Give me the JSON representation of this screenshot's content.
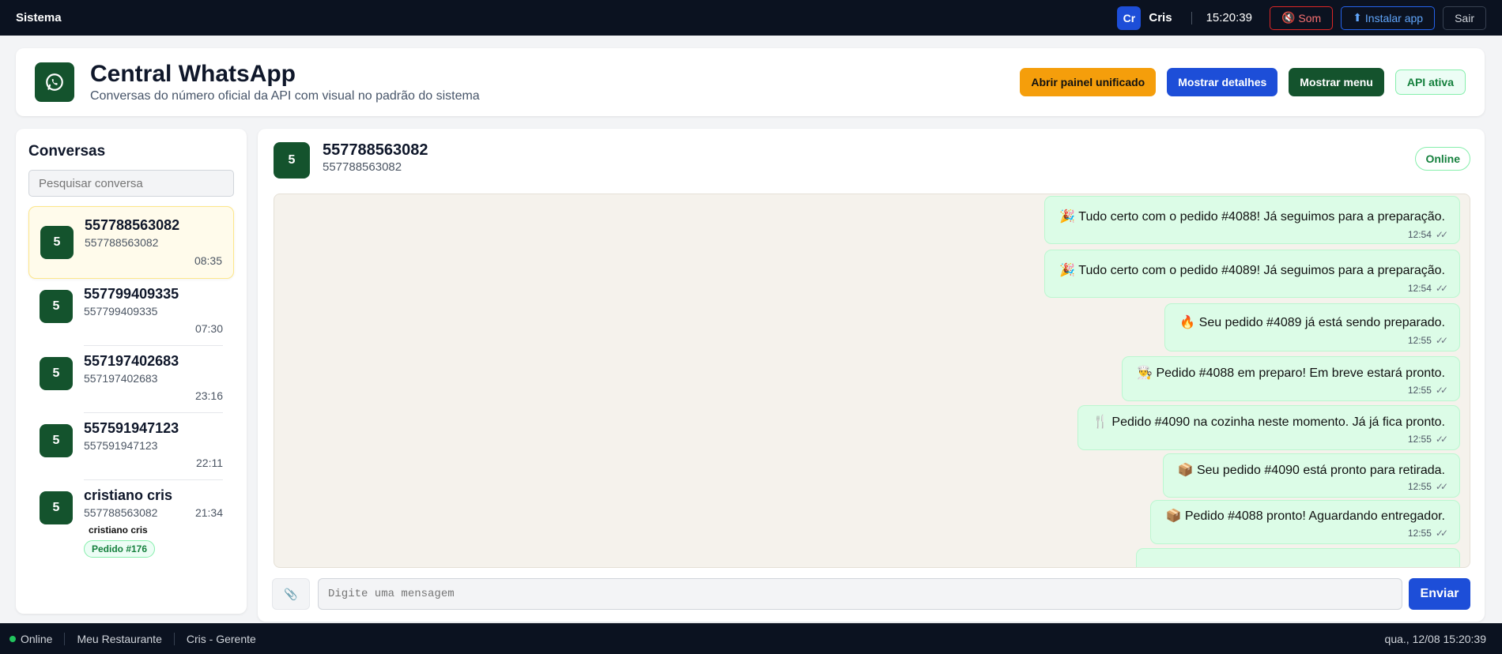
{
  "topbar": {
    "system_label": "Sistema",
    "user_initials": "Cr",
    "user_name": "Cris",
    "clock": "15:20:39",
    "sound_label": "Som",
    "install_label": "Instalar app",
    "logout_label": "Sair"
  },
  "header": {
    "title": "Central WhatsApp",
    "subtitle": "Conversas do número oficial da API com visual no padrão do sistema",
    "btn_unified": "Abrir painel unificado",
    "btn_details": "Mostrar detalhes",
    "btn_menu": "Mostrar menu",
    "api_status": "API ativa"
  },
  "sidebar": {
    "title": "Conversas",
    "search_placeholder": "Pesquisar conversa",
    "conversations": [
      {
        "initial": "5",
        "name": "557788563082",
        "number": "557788563082",
        "time": "08:35"
      },
      {
        "initial": "5",
        "name": "557799409335",
        "number": "557799409335",
        "time": "07:30"
      },
      {
        "initial": "5",
        "name": "557197402683",
        "number": "557197402683",
        "time": "23:16"
      },
      {
        "initial": "5",
        "name": "557591947123",
        "number": "557591947123",
        "time": "22:11"
      },
      {
        "initial": "5",
        "name": "cristiano cris",
        "number": "557788563082",
        "time": "21:34",
        "sub": "cristiano cris",
        "badge": "Pedido #176"
      }
    ]
  },
  "chat": {
    "initial": "5",
    "name": "557788563082",
    "number": "557788563082",
    "status": "Online",
    "messages": [
      {
        "emoji": "🎉",
        "text": "Tudo certo com o pedido #4088! Já seguimos para a preparação.",
        "time": "12:54"
      },
      {
        "emoji": "🎉",
        "text": "Tudo certo com o pedido #4089! Já seguimos para a preparação.",
        "time": "12:54"
      },
      {
        "emoji": "🔥",
        "text": "Seu pedido #4089 já está sendo preparado.",
        "time": "12:55"
      },
      {
        "emoji": "👨‍🍳",
        "text": "Pedido #4088 em preparo! Em breve estará pronto.",
        "time": "12:55"
      },
      {
        "emoji": "🍴",
        "text": "Pedido #4090 na cozinha neste momento. Já já fica pronto.",
        "time": "12:55"
      },
      {
        "emoji": "📦",
        "text": "Seu pedido #4090 está pronto para retirada.",
        "time": "12:55"
      },
      {
        "emoji": "📦",
        "text": "Pedido #4088 pronto! Aguardando entregador.",
        "time": "12:55"
      }
    ],
    "input_placeholder": "Digite uma mensagem",
    "send_label": "Enviar"
  },
  "statusbar": {
    "online": "Online",
    "restaurant": "Meu Restaurante",
    "user_role": "Cris - Gerente",
    "datetime": "qua., 12/08 15:20:39"
  },
  "colors": {
    "brand_green": "#14532d",
    "primary_blue": "#1d4ed8",
    "accent_orange": "#f59e0b",
    "bubble_green": "#dcfce7",
    "topbar_dark": "#0b1220"
  }
}
